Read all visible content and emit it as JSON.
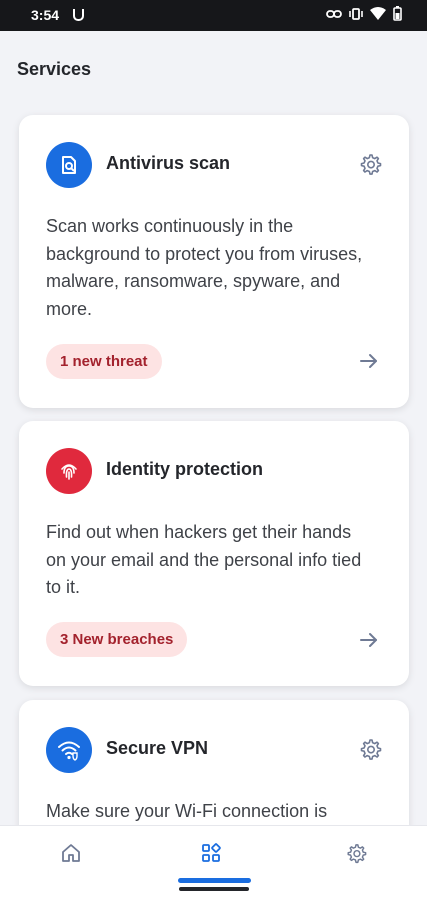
{
  "status_bar": {
    "time": "3:54",
    "left_icon": "notification-icon",
    "right_icons": [
      "link-icon",
      "vibrate-icon",
      "wifi-icon",
      "battery-icon"
    ]
  },
  "page": {
    "title": "Services"
  },
  "services": [
    {
      "title": "Antivirus scan",
      "description": "Scan works continuously in the background to protect you from viruses, malware, ransomware, spyware, and more.",
      "badge": "1 new threat",
      "icon": "antivirus-scan-icon",
      "icon_color": "#1a6de0"
    },
    {
      "title": "Identity protection",
      "description": "Find out when hackers get their hands on your email and the personal info tied to it.",
      "badge": "3 New breaches",
      "icon": "fingerprint-icon",
      "icon_color": "#e0293d"
    },
    {
      "title": "Secure VPN",
      "description": "Make sure your Wi-Fi connection is",
      "icon": "secure-wifi-icon",
      "icon_color": "#1a6de0"
    }
  ],
  "bottom_nav": {
    "items": [
      "home-icon",
      "services-grid-icon",
      "settings-gear-icon"
    ],
    "active_item": "services-grid-icon",
    "active_color": "#1a6de0"
  },
  "colors": {
    "badge_bg": "#fde3e3",
    "badge_text": "#a3222d",
    "page_bg": "#f2f3f7"
  }
}
